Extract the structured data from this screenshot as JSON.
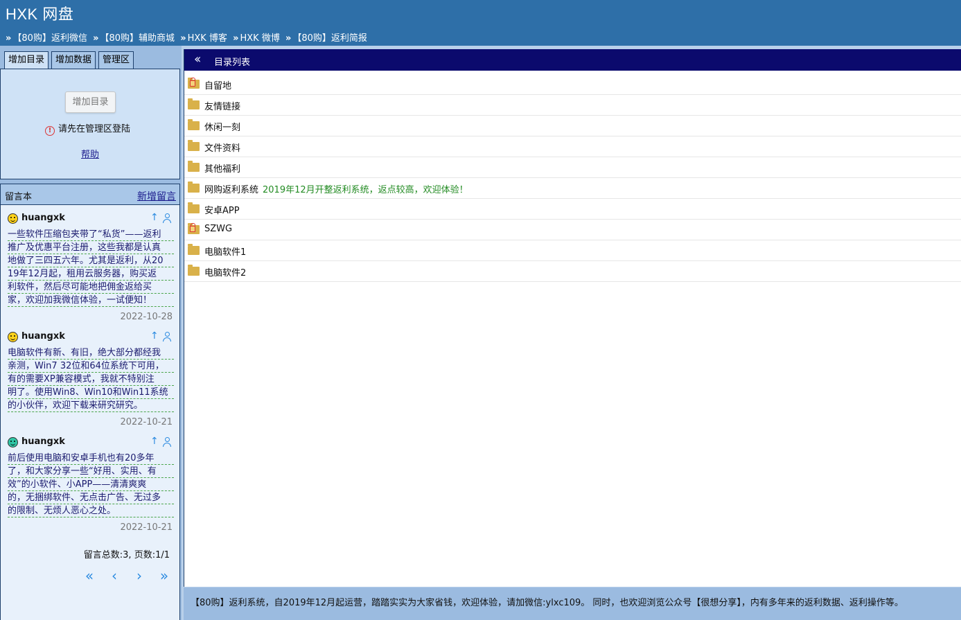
{
  "header": {
    "title": "HXK 网盘",
    "nav": [
      "【80购】返利微信",
      "【80购】辅助商城",
      "HXK 博客",
      "HXK 微博",
      "【80购】返利简报"
    ],
    "nav_separator": "»"
  },
  "tabs": [
    {
      "label": "增加目录",
      "active": true
    },
    {
      "label": "增加数据",
      "active": false
    },
    {
      "label": "管理区",
      "active": false
    }
  ],
  "add_dir_panel": {
    "button_label": "增加目录",
    "warning_icon": "exclamation-circle-icon",
    "warning_text": "请先在管理区登陆",
    "help_link": "帮助"
  },
  "guestbook": {
    "title": "留言本",
    "new_link": "新增留言",
    "messages": [
      {
        "user": "huangxk",
        "avatar": "smiley-yellow-icon",
        "lines": [
          "一些软件压缩包夹带了“私货”——返利",
          "推广及优惠平台注册，这些我都是认真",
          "地做了三四五六年。尤其是返利，从20",
          "19年12月起，租用云服务器，购买返",
          "利软件，然后尽可能地把佣金返给买",
          "家，欢迎加我微信体验，一试便知！"
        ],
        "date": "2022-10-28"
      },
      {
        "user": "huangxk",
        "avatar": "smiley-yellow-icon",
        "lines": [
          "电脑软件有新、有旧，绝大部分都经我",
          "亲测，Win7 32位和64位系统下可用，",
          "有的需要XP兼容模式，我就不特别注",
          "明了。使用Win8、Win10和Win11系统",
          "的小伙伴，欢迎下载来研究研究。"
        ],
        "date": "2022-10-21"
      },
      {
        "user": "huangxk",
        "avatar": "smiley-teal-icon",
        "lines": [
          "前后使用电脑和安卓手机也有20多年",
          "了，和大家分享一些“好用、实用、有",
          "效”的小软件、小APP——清清爽爽",
          "的，无捆绑软件、无点击广告、无过多",
          "的限制、无烦人恶心之处。"
        ],
        "date": "2022-10-21"
      }
    ],
    "stats": "留言总数:3, 页数:1/1",
    "pager": [
      "«",
      "‹",
      "›",
      "»"
    ]
  },
  "main": {
    "title": "目录列表",
    "collapse_icon": "double-chevron-left-icon",
    "dirs": [
      {
        "name": "自留地",
        "locked": true,
        "note": ""
      },
      {
        "name": "友情链接",
        "locked": false,
        "note": ""
      },
      {
        "name": "休闲一刻",
        "locked": false,
        "note": ""
      },
      {
        "name": "文件资料",
        "locked": false,
        "note": ""
      },
      {
        "name": "其他福利",
        "locked": false,
        "note": ""
      },
      {
        "name": "网购返利系统",
        "locked": false,
        "note": "2019年12月开整返利系统，返点较高，欢迎体验！"
      },
      {
        "name": "安卓APP",
        "locked": false,
        "note": ""
      },
      {
        "name": "SZWG",
        "locked": true,
        "note": ""
      },
      {
        "name": "电脑软件1",
        "locked": false,
        "note": ""
      },
      {
        "name": "电脑软件2",
        "locked": false,
        "note": ""
      }
    ]
  },
  "footer": {
    "text": "【80购】返利系统，自2019年12月起运营，踏踏实实为大家省钱，欢迎体验，请加微信:ylxc109。 同时，也欢迎浏览公众号【很想分享】，内有多年来的返利数据、返利操作等。"
  },
  "colors": {
    "header_bg": "#2e6fa8",
    "main_header_bg": "#0b0a6d",
    "panel_bg": "#cfe2f6",
    "folder": "#d9b14a",
    "note_green": "#228b22"
  }
}
